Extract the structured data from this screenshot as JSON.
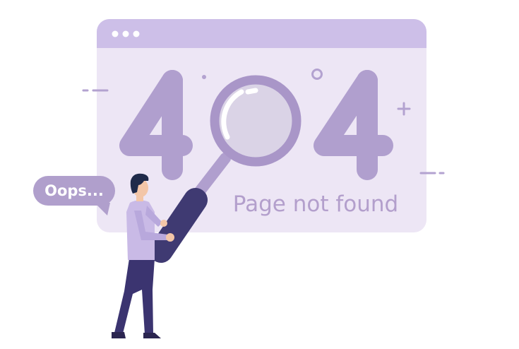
{
  "illustration": {
    "code": "404",
    "message": "Page not found",
    "speech": "Oops..."
  },
  "colors": {
    "window_bg": "#ede6f5",
    "window_bar": "#cdbfe8",
    "digits": "#b09fce",
    "lens": "#dad3e6",
    "handle": "#3f3a72",
    "trousers": "#3b3470",
    "shirt": "#c9bae6",
    "bubble": "#b09fcc"
  },
  "icons": [
    "window-dots-icon",
    "magnifier-icon",
    "plus-icon"
  ]
}
